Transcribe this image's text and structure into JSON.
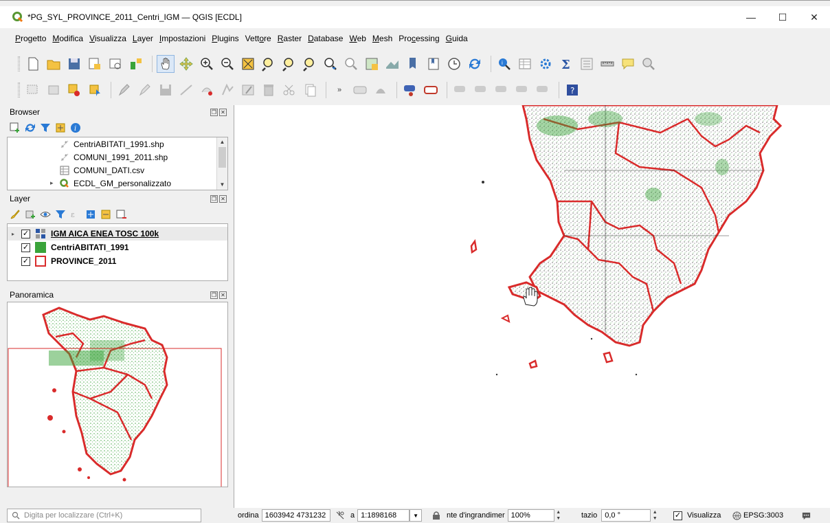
{
  "window": {
    "title": "*PG_SYL_PROVINCE_2011_Centri_IGM — QGIS [ECDL]",
    "minimize_label": "—",
    "maximize_label": "☐",
    "close_label": "✕"
  },
  "menu": {
    "items": [
      {
        "u": "P",
        "rest": "rogetto"
      },
      {
        "u": "M",
        "rest": "odifica"
      },
      {
        "u": "V",
        "rest": "isualizza"
      },
      {
        "u": "L",
        "rest": "ayer"
      },
      {
        "u": "I",
        "rest": "mpostazioni"
      },
      {
        "u": "P",
        "rest": "lugins"
      },
      {
        "pre": "Vett",
        "u": "o",
        "rest": "re"
      },
      {
        "u": "R",
        "rest": "aster"
      },
      {
        "u": "D",
        "rest": "atabase"
      },
      {
        "u": "W",
        "rest": "eb"
      },
      {
        "u": "M",
        "rest": "esh"
      },
      {
        "pre": "Pro",
        "u": "c",
        "rest": "essing"
      },
      {
        "u": "G",
        "rest": "uida"
      }
    ]
  },
  "browser": {
    "title": "Browser",
    "items": [
      {
        "label": "CentriABITATI_1991.shp",
        "icon": "point-layer-icon"
      },
      {
        "label": "COMUNI_1991_2011.shp",
        "icon": "point-layer-icon"
      },
      {
        "label": "COMUNI_DATI.csv",
        "icon": "table-icon"
      },
      {
        "label": "ECDL_GM_personalizzato",
        "icon": "qgis-project-icon"
      }
    ]
  },
  "layers": {
    "title": "Layer",
    "items": [
      {
        "label": "IGM AICA ENEA TOSC 100k",
        "checked": "✓",
        "icon": "raster-icon"
      },
      {
        "label": "CentriABITATI_1991",
        "checked": "✓",
        "icon": "green-fill-symbol",
        "color": "#3aa33a"
      },
      {
        "label": "PROVINCE_2011",
        "checked": "✓",
        "icon": "red-outline-symbol",
        "color": "#d92b2b"
      }
    ]
  },
  "overview": {
    "title": "Panoramica"
  },
  "status": {
    "locator_placeholder": "Digita per localizzare (Ctrl+K)",
    "coord_label": "ordina",
    "coord_value": "1603942 4731232",
    "scale_label": "a",
    "scale_value": "1:1898168",
    "magnifier_label": "nte d'ingrandimer",
    "magnifier_value": "100%",
    "rotation_label": "tazio",
    "rotation_value": "0,0 °",
    "render_label": "Visualizza",
    "render_checked": "✓",
    "crs_label": "EPSG:3003"
  },
  "colors": {
    "province_outline": "#d92b2b",
    "settlements": "#3aa33a",
    "accent": "#2a7ad5"
  }
}
